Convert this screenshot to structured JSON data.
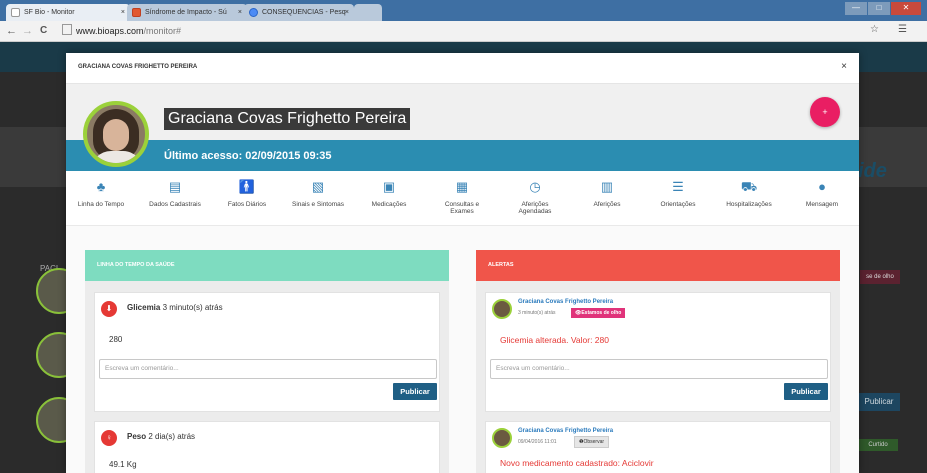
{
  "browser": {
    "tabs": [
      {
        "label": "SF Bio - Monitor",
        "active": true
      },
      {
        "label": "Síndrome de Impacto - Sú",
        "active": false
      },
      {
        "label": "CONSEQUENCIAS - Pesq",
        "active": false
      }
    ],
    "tab_close": "×",
    "url_host": "www.bioaps.com",
    "url_path": "/monitor#",
    "nav_back": "←",
    "nav_forward": "→",
    "nav_reload": "C",
    "window_controls": [
      "—",
      "□",
      "✕"
    ]
  },
  "background": {
    "side_text": "ide",
    "pac_text": "PACI",
    "purple_badge": "se de olho",
    "publish": "Publicar",
    "green_badge": "Curtido"
  },
  "modal": {
    "title": "GRACIANA COVAS FRIGHETTO PEREIRA",
    "close": "×",
    "patient_name": "Graciana Covas Frighetto Pereira",
    "last_access": "Último acesso: 02/09/2015 09:35",
    "fab_icon": "+",
    "nav": [
      {
        "label": "Linha do Tempo",
        "icon": "timeline-icon",
        "glyph": "♣"
      },
      {
        "label": "Dados Cadastrais",
        "icon": "id-card-icon",
        "glyph": "▤"
      },
      {
        "label": "Fatos Diários",
        "icon": "person-icon",
        "glyph": "🚹"
      },
      {
        "label": "Sinais e Sintomas",
        "icon": "image-icon",
        "glyph": "▧"
      },
      {
        "label": "Medicações",
        "icon": "medkit-icon",
        "glyph": "▣"
      },
      {
        "label": "Consultas e Exames",
        "icon": "calendar-icon",
        "glyph": "▦"
      },
      {
        "label": "Aferições Agendadas",
        "icon": "clock-icon",
        "glyph": "◷"
      },
      {
        "label": "Aferições",
        "icon": "bar-chart-icon",
        "glyph": "▥"
      },
      {
        "label": "Orientações",
        "icon": "list-icon",
        "glyph": "☰"
      },
      {
        "label": "Hospitalizações",
        "icon": "ambulance-icon",
        "glyph": "⛟"
      },
      {
        "label": "Mensagem",
        "icon": "chat-icon",
        "glyph": "●"
      }
    ],
    "timeline": {
      "header": "LINHA DO TEMPO DA SAÚDE",
      "header_color": "#7edcc0",
      "posts": [
        {
          "title": "Glicemia",
          "time": "3 minuto(s) atrás",
          "value": "280",
          "icon": "drop-icon",
          "glyph": "⬇",
          "comment_placeholder": "Escreva um comentário...",
          "publish": "Publicar"
        },
        {
          "title": "Peso",
          "time": "2 dia(s) atrás",
          "value": "49.1 Kg",
          "icon": "scale-icon",
          "glyph": "♀"
        }
      ]
    },
    "alerts": {
      "header": "ALERTAS",
      "header_color": "#f0554a",
      "items": [
        {
          "author": "Graciana Covas Frighetto Pereira",
          "meta": "3 minuto(s) atrás",
          "tag": "👁Estamos de olho",
          "text": "Glicemia alterada. Valor: 280",
          "comment_placeholder": "Escreva um comentário...",
          "publish": "Publicar"
        },
        {
          "author": "Graciana Covas Frighetto Pereira",
          "meta": "09/04/2016 11:01",
          "tag": "❶Observar",
          "text": "Novo medicamento cadastrado: Aciclovir"
        }
      ]
    }
  },
  "colors": {
    "accent_blue": "#2b8db1",
    "fab_pink": "#e91e63",
    "avatar_ring": "#9bd13a",
    "publish_blue": "#1f5f85"
  }
}
